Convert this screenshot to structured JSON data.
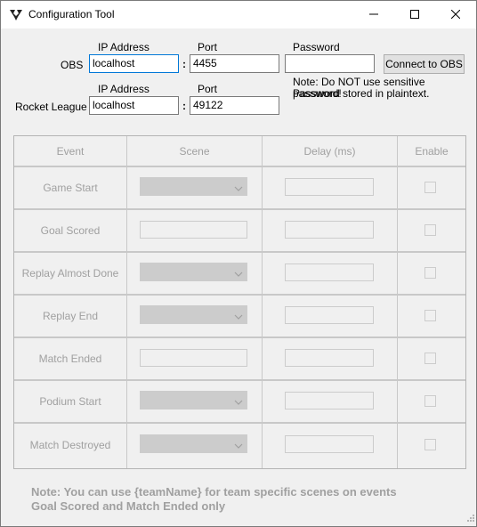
{
  "window": {
    "title": "Configuration Tool"
  },
  "obs": {
    "row_label": "OBS",
    "ip_label": "IP Address",
    "port_label": "Port",
    "password_label": "Password",
    "ip_value": "localhost",
    "port_value": "4455",
    "password_value": "",
    "colon": ":",
    "connect_label": "Connect to OBS",
    "note_line1": "Note: Do NOT use sensitive password!",
    "note_line2": "Password stored in plaintext."
  },
  "rocket_league": {
    "row_label": "Rocket League",
    "ip_label": "IP Address",
    "port_label": "Port",
    "ip_value": "localhost",
    "port_value": "49122",
    "colon": ":"
  },
  "grid": {
    "headers": [
      "Event",
      "Scene",
      "Delay (ms)",
      "Enable"
    ],
    "rows": [
      {
        "event": "Game Start",
        "scene_control": "combo",
        "delay": "",
        "enabled": false
      },
      {
        "event": "Goal Scored",
        "scene_control": "textbox",
        "delay": "",
        "enabled": false
      },
      {
        "event": "Replay Almost Done",
        "scene_control": "combo",
        "delay": "",
        "enabled": false
      },
      {
        "event": "Replay End",
        "scene_control": "combo",
        "delay": "",
        "enabled": false
      },
      {
        "event": "Match Ended",
        "scene_control": "textbox",
        "delay": "",
        "enabled": false
      },
      {
        "event": "Podium Start",
        "scene_control": "combo",
        "delay": "",
        "enabled": false
      },
      {
        "event": "Match Destroyed",
        "scene_control": "combo",
        "delay": "",
        "enabled": false
      }
    ]
  },
  "footer": {
    "note_line1": "Note: You can use {teamName} for team specific scenes on events",
    "note_line2": "Goal Scored and Match Ended only"
  },
  "colors": {
    "disabled_text": "#a0a0a0",
    "focus_border": "#0078d7",
    "window_bg": "#f0f0f0"
  },
  "icons": {
    "app": "app-icon",
    "minimize": "minimize-icon",
    "maximize": "maximize-icon",
    "close": "close-icon",
    "dropdown": "chevron-down-icon"
  }
}
